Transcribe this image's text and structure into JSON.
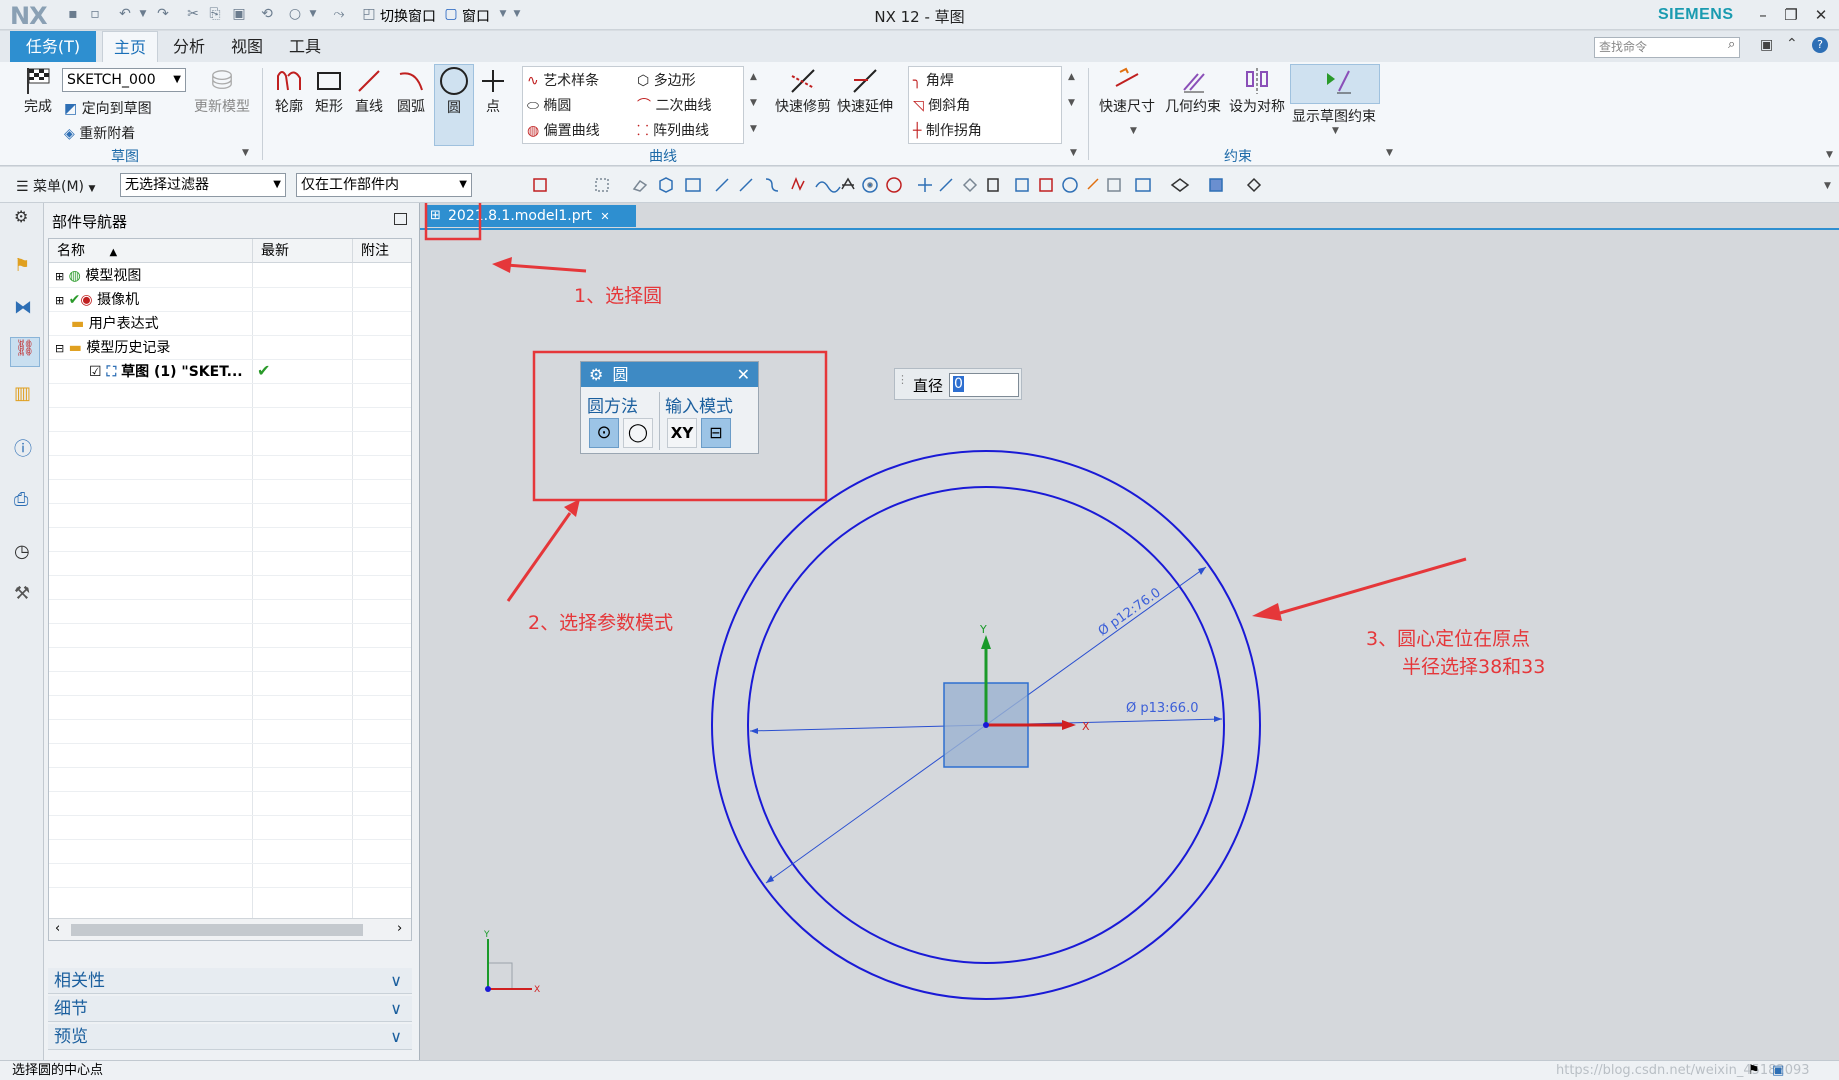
{
  "window": {
    "app_logo": "NX",
    "title": "NX 12 - 草图",
    "brand": "SIEMENS",
    "quick_access": {
      "switch_window": "切换窗口",
      "window": "窗口"
    }
  },
  "menu_tabs": {
    "task": "任务(T)",
    "home": "主页",
    "analysis": "分析",
    "view": "视图",
    "tools": "工具"
  },
  "search": {
    "placeholder": "查找命令"
  },
  "ribbon": {
    "sketch_group": {
      "finish": "完成",
      "sketch_name": "SKETCH_000",
      "orient_to_sketch": "定向到草图",
      "reattach": "重新附着",
      "update_model": "更新模型",
      "label": "草图"
    },
    "curve_group": {
      "profile": "轮廓",
      "rectangle": "矩形",
      "line": "直线",
      "arc": "圆弧",
      "circle": "圆",
      "point": "点",
      "studio_spline": "艺术样条",
      "polygon": "多边形",
      "ellipse": "椭圆",
      "conic": "二次曲线",
      "offset_curve": "偏置曲线",
      "pattern_curve": "阵列曲线",
      "quick_trim": "快速修剪",
      "quick_extend": "快速延伸",
      "fillet": "角焊",
      "chamfer": "倒斜角",
      "make_corner": "制作拐角",
      "label": "曲线"
    },
    "constraints_group": {
      "rapid_dimension": "快速尺寸",
      "geometric_constraints": "几何约束",
      "make_symmetric": "设为对称",
      "show_constraints": "显示草图约束",
      "label": "约束"
    }
  },
  "toolbar2": {
    "menu": "菜单(M)",
    "filter": "无选择过滤器",
    "scope": "仅在工作部件内"
  },
  "navigator": {
    "title": "部件导航器",
    "columns": [
      "名称",
      "最新",
      "附注"
    ],
    "items": [
      {
        "label": "模型视图",
        "level": 0
      },
      {
        "label": "摄像机",
        "level": 0
      },
      {
        "label": "用户表达式",
        "level": 0
      },
      {
        "label": "模型历史记录",
        "level": 0
      },
      {
        "label": "草图 (1) \"SKET...",
        "level": 1
      }
    ],
    "panels": [
      "相关性",
      "细节",
      "预览"
    ]
  },
  "document_tab": "2021.8.1.model1.prt",
  "circle_dialog": {
    "title": "圆",
    "method_label": "圆方法",
    "input_mode_label": "输入模式",
    "xy_label": "XY"
  },
  "diameter_input": {
    "label": "直径",
    "value": "0"
  },
  "dimensions": {
    "outer": "Ø p12:76.0",
    "inner": "Ø p13:66.0"
  },
  "axis_labels": {
    "x": "X",
    "y": "Y"
  },
  "annotations": {
    "step1": "1、选择圆",
    "step2": "2、选择参数模式",
    "step3_line1": "3、圆心定位在原点",
    "step3_line2": "半径选择38和33"
  },
  "status_text": "选择圆的中心点",
  "watermark": "https://blog.csdn.net/weixin_45182093",
  "colors": {
    "accent": "#2e8fd0",
    "sketch_curve": "#1a1ad6",
    "annotation": "#e5373a"
  }
}
